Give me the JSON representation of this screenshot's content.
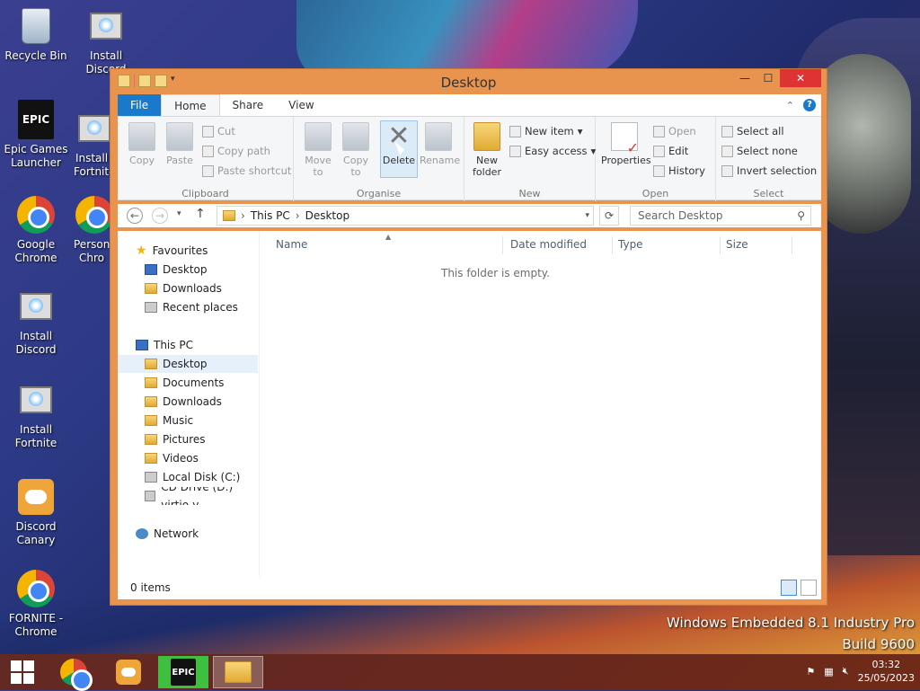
{
  "desktop": {
    "icons": [
      {
        "label": "Recycle Bin"
      },
      {
        "label": "Install Discord"
      },
      {
        "label": "Epic Games Launcher"
      },
      {
        "label": "Install Fortnite"
      },
      {
        "label": "Google Chrome"
      },
      {
        "label": "Person Chro"
      },
      {
        "label": "Install Discord"
      },
      {
        "label": "Install Fortnite"
      },
      {
        "label": "Discord Canary"
      },
      {
        "label": "FORNITE - Chrome"
      }
    ],
    "watermark_line1": "Windows Embedded 8.1 Industry Pro",
    "watermark_line2": "Build 9600"
  },
  "window": {
    "title": "Desktop",
    "tabs": [
      "File",
      "Home",
      "Share",
      "View"
    ],
    "active_tab": "Home",
    "ribbon": {
      "clipboard": {
        "label": "Clipboard",
        "copy": "Copy",
        "paste": "Paste",
        "cut": "Cut",
        "copy_path": "Copy path",
        "paste_shortcut": "Paste shortcut"
      },
      "organise": {
        "label": "Organise",
        "move_to": "Move to",
        "copy_to": "Copy to",
        "delete": "Delete",
        "rename": "Rename"
      },
      "new": {
        "label": "New",
        "new_folder": "New folder",
        "new_item": "New item",
        "easy_access": "Easy access"
      },
      "open": {
        "label": "Open",
        "properties": "Properties",
        "open": "Open",
        "edit": "Edit",
        "history": "History"
      },
      "select": {
        "label": "Select",
        "select_all": "Select all",
        "select_none": "Select none",
        "invert_selection": "Invert selection"
      }
    },
    "address": {
      "crumbs": [
        "This PC",
        "Desktop"
      ],
      "search_placeholder": "Search Desktop"
    },
    "nav": {
      "favourites": "Favourites",
      "fav_items": [
        "Desktop",
        "Downloads",
        "Recent places"
      ],
      "this_pc": "This PC",
      "pc_items": [
        "Desktop",
        "Documents",
        "Downloads",
        "Music",
        "Pictures",
        "Videos",
        "Local Disk (C:)",
        "CD Drive (D:) virtio-v"
      ],
      "network": "Network"
    },
    "columns": [
      "Name",
      "Date modified",
      "Type",
      "Size"
    ],
    "empty_text": "This folder is empty.",
    "status": "0 items"
  },
  "taskbar": {
    "time": "03:32",
    "date": "25/05/2023",
    "epic_label": "EPIC"
  }
}
